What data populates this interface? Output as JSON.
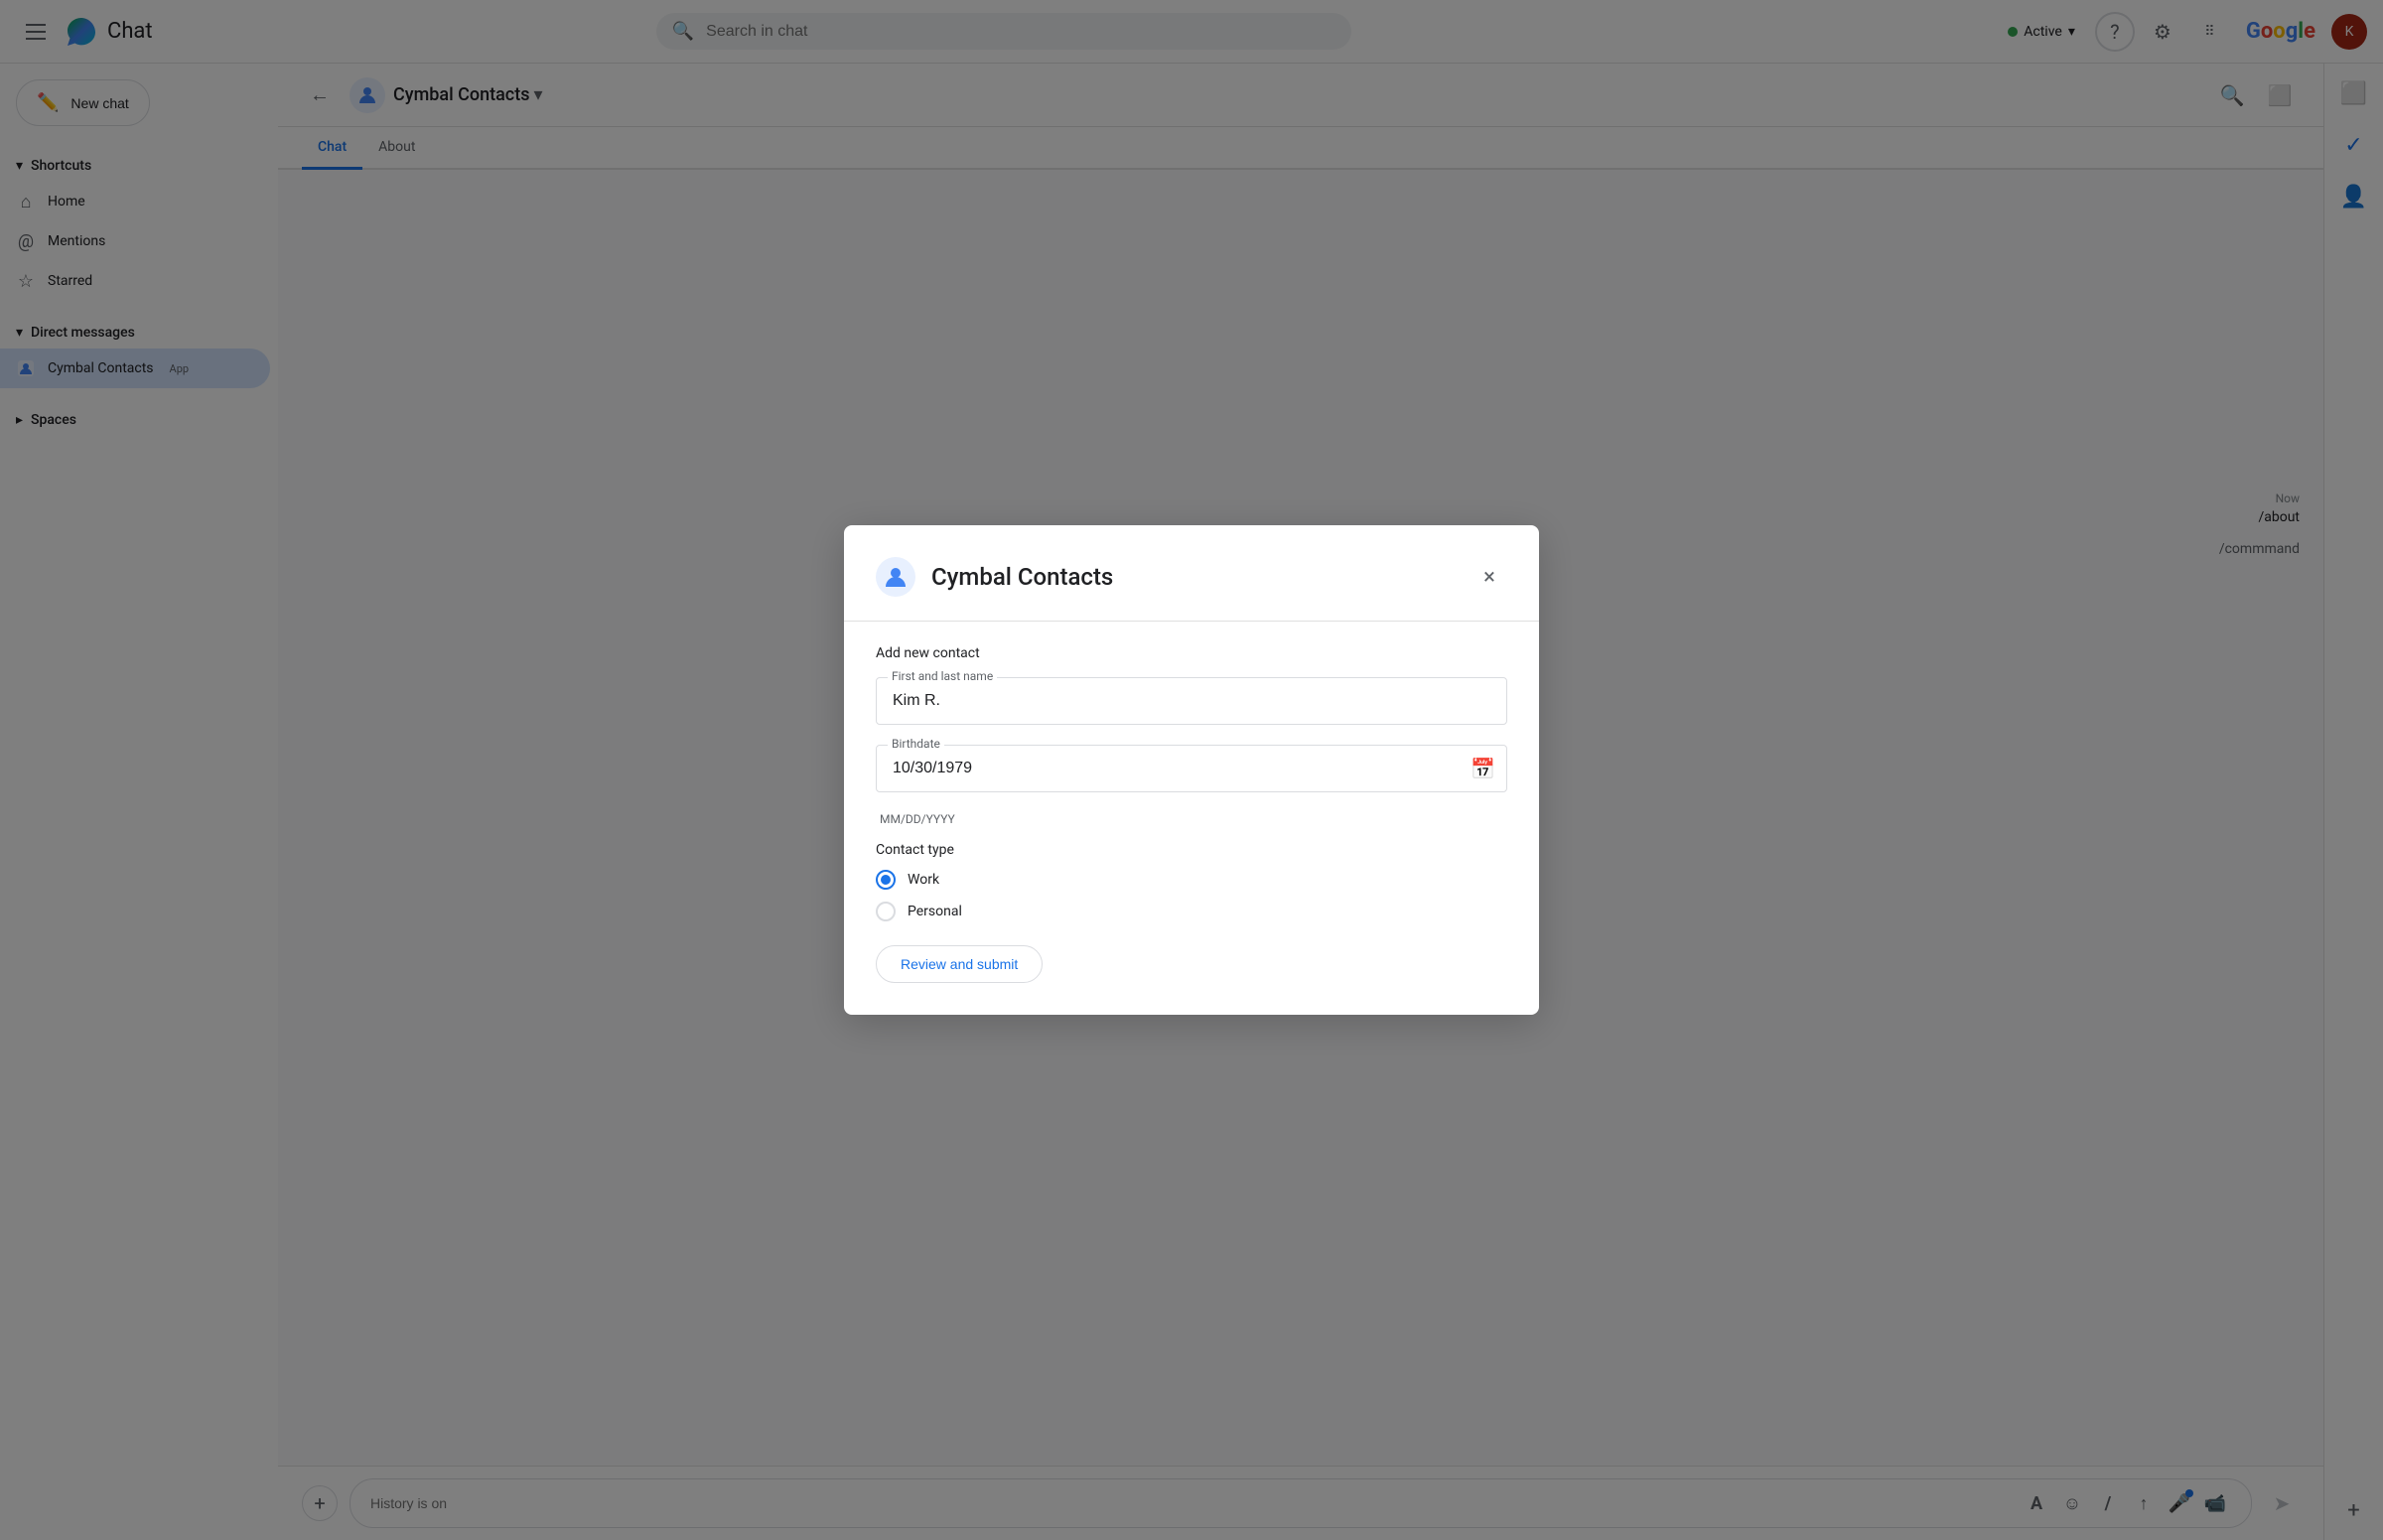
{
  "topbar": {
    "app_name": "Chat",
    "search_placeholder": "Search in chat",
    "status_label": "Active",
    "google_text": "Google"
  },
  "sidebar": {
    "new_chat_label": "New chat",
    "shortcuts_label": "Shortcuts",
    "home_label": "Home",
    "mentions_label": "Mentions",
    "starred_label": "Starred",
    "direct_messages_label": "Direct messages",
    "cymbal_contacts_label": "Cymbal Contacts",
    "cymbal_contacts_tag": "App",
    "spaces_label": "Spaces"
  },
  "channel_header": {
    "app_name": "Cymbal Contacts",
    "dropdown_icon": "▾"
  },
  "tabs": [
    {
      "label": "Chat",
      "active": true
    },
    {
      "label": "About",
      "active": false
    }
  ],
  "chat": {
    "timestamp": "Now",
    "message": "/about",
    "command_text": "mmand"
  },
  "input": {
    "placeholder": "History is on"
  },
  "modal": {
    "title": "Cymbal Contacts",
    "section_label": "Add new contact",
    "first_name_label": "First and last name",
    "first_name_value": "Kim R.",
    "birthdate_label": "Birthdate",
    "birthdate_value": "10/30/1979",
    "birthdate_hint": "MM/DD/YYYY",
    "contact_type_label": "Contact type",
    "options": [
      {
        "label": "Work",
        "selected": true
      },
      {
        "label": "Personal",
        "selected": false
      }
    ],
    "submit_button": "Review and submit"
  },
  "right_rail": {
    "plus_icon": "+",
    "contacts_icon": "👤"
  },
  "icons": {
    "hamburger": "☰",
    "back": "←",
    "search": "🔍",
    "help": "?",
    "gear": "⚙",
    "grid": "⋮⋮⋮",
    "chevron_down": "▾",
    "close": "×",
    "calendar": "📅",
    "add": "+",
    "format": "A",
    "emoji": "☺",
    "slash": "/",
    "upload": "↑",
    "mic": "🎤",
    "video": "📹",
    "send": "➤",
    "home": "⌂",
    "mention": "@",
    "star": "☆",
    "message": "💬",
    "search_header": "🔍",
    "window": "⬜"
  }
}
